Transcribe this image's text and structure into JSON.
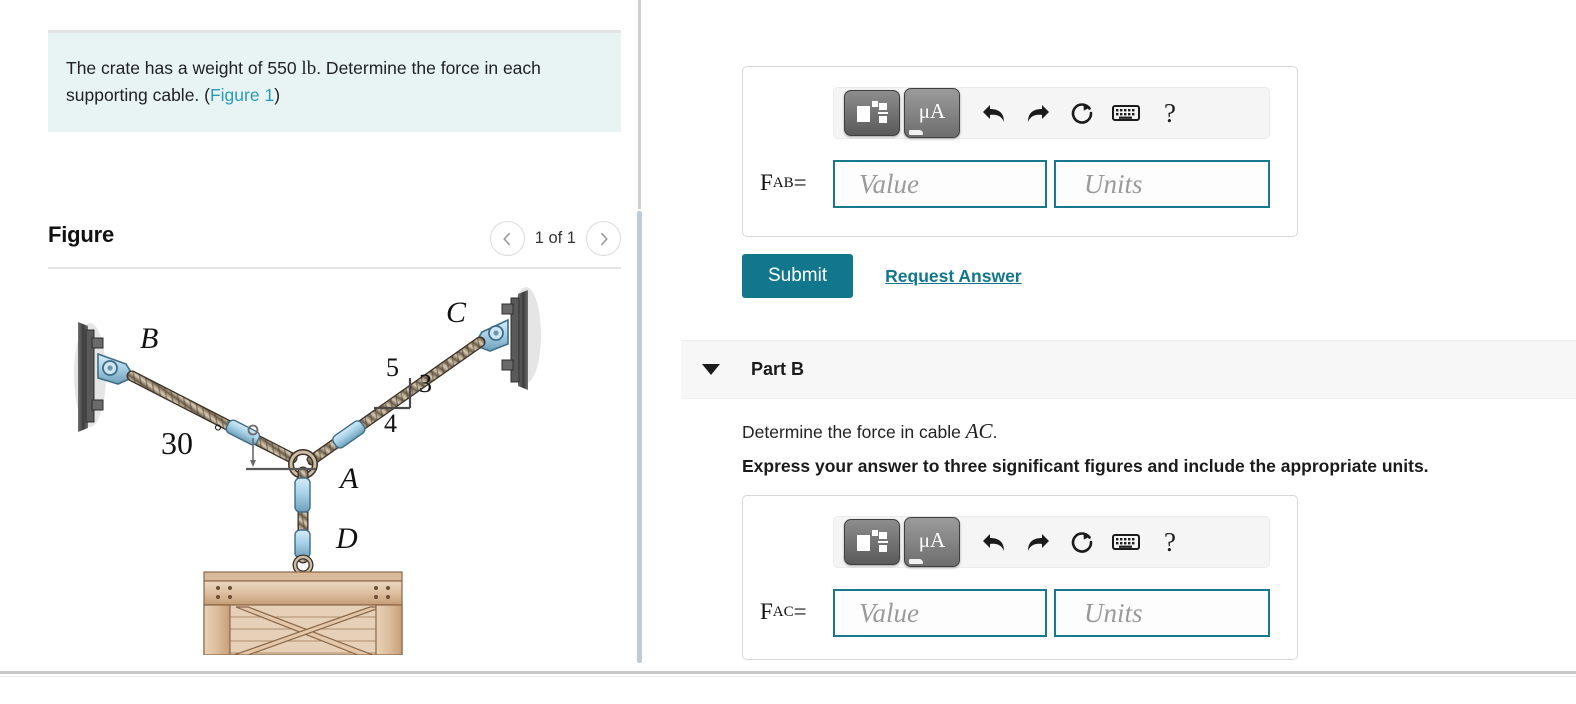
{
  "problem": {
    "text_before": "The crate has a weight of 550 ",
    "unit": "lb",
    "text_after": ". Determine the force in each supporting cable. (",
    "figure_link": "Figure 1",
    "text_end": ")"
  },
  "figure": {
    "title": "Figure",
    "counter": "1 of 1",
    "prev_icon": "chevron-left-icon",
    "next_icon": "chevron-right-icon",
    "labels": {
      "point_b": "B",
      "point_c": "C",
      "point_a": "A",
      "point_d": "D",
      "angle": "30",
      "degree": "°",
      "slope_hyp": "5",
      "slope_vert": "3",
      "slope_horiz": "4"
    },
    "colors": {
      "rope": "#6b5a46",
      "rope_light": "#cbbda8",
      "fitting": "#9cc8e0",
      "fitting_edge": "#4d7b93",
      "wall": "#4a4a4a",
      "crate_light": "#e3c7ab",
      "crate_mid": "#d2ae8d",
      "crate_dark": "#a87f5c"
    }
  },
  "part_a": {
    "label_prefix": "F",
    "label_sub": "AB",
    "label_eq": " =",
    "value_placeholder": "Value",
    "units_placeholder": "Units",
    "toolbar": {
      "template_icon": "math-template-icon",
      "units_label": "μA",
      "undo_icon": "undo-icon",
      "redo_icon": "redo-icon",
      "reset_icon": "reset-icon",
      "keyboard_icon": "keyboard-icon",
      "help_icon": "help-icon",
      "help_label": "?"
    }
  },
  "submit": {
    "submit_label": "Submit",
    "request_answer_label": "Request Answer",
    "accent_color": "#12768d"
  },
  "part_b": {
    "caret_icon": "caret-down-icon",
    "title": "Part B",
    "question_before": "Determine the force in cable ",
    "question_math": "AC",
    "question_after": ".",
    "instruction": "Express your answer to three significant figures and include the appropriate units.",
    "label_prefix": "F",
    "label_sub": "AC",
    "label_eq": " =",
    "value_placeholder": "Value",
    "units_placeholder": "Units",
    "toolbar": {
      "template_icon": "math-template-icon",
      "units_label": "μA",
      "undo_icon": "undo-icon",
      "redo_icon": "redo-icon",
      "reset_icon": "reset-icon",
      "keyboard_icon": "keyboard-icon",
      "help_icon": "help-icon",
      "help_label": "?"
    }
  },
  "theme": {
    "statement_bg": "#e8f4f4",
    "link_color": "#2a9bb5",
    "input_border": "#18788f",
    "band_bg": "#f7f7f7"
  }
}
